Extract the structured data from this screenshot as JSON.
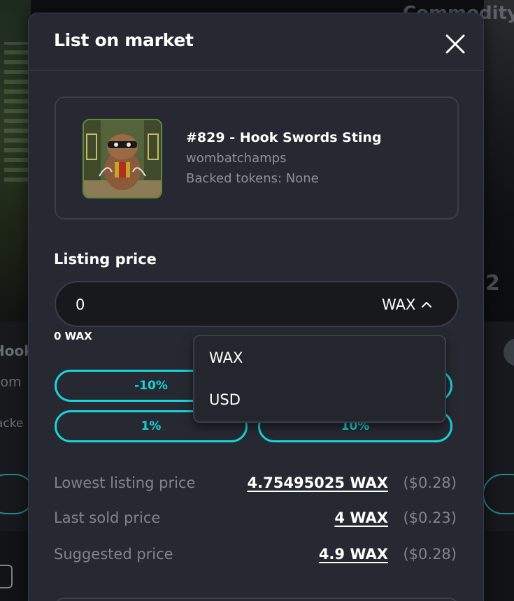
{
  "background": {
    "partial_heading": "Commodity",
    "partial_name": "Hook",
    "partial_collection": "/om",
    "partial_backed": "acke",
    "partial_number": "2"
  },
  "modal": {
    "title": "List on market",
    "close_icon": "close-icon"
  },
  "asset": {
    "name": "#829 - Hook Swords Sting",
    "collection": "wombatchamps",
    "backed_tokens": "Backed tokens: None"
  },
  "listing": {
    "label": "Listing price",
    "value": "0",
    "currency": "WAX",
    "converted": "0 WAX"
  },
  "currency_menu": {
    "options": [
      "WAX",
      "USD"
    ]
  },
  "adjust_buttons": {
    "minus10": "-10%",
    "plus1": "1%",
    "plus10": "10%"
  },
  "stats": {
    "lowest": {
      "label": "Lowest listing price",
      "value": "4.75495025 WAX",
      "usd": "($0.28)"
    },
    "last_sold": {
      "label": "Last sold price",
      "value": "4 WAX",
      "usd": "($0.23)"
    },
    "suggested": {
      "label": "Suggested price",
      "value": "4.9 WAX",
      "usd": "($0.28)"
    }
  },
  "colors": {
    "accent": "#19d3d8",
    "modal_bg": "#262931",
    "muted_text": "#7f858f"
  }
}
